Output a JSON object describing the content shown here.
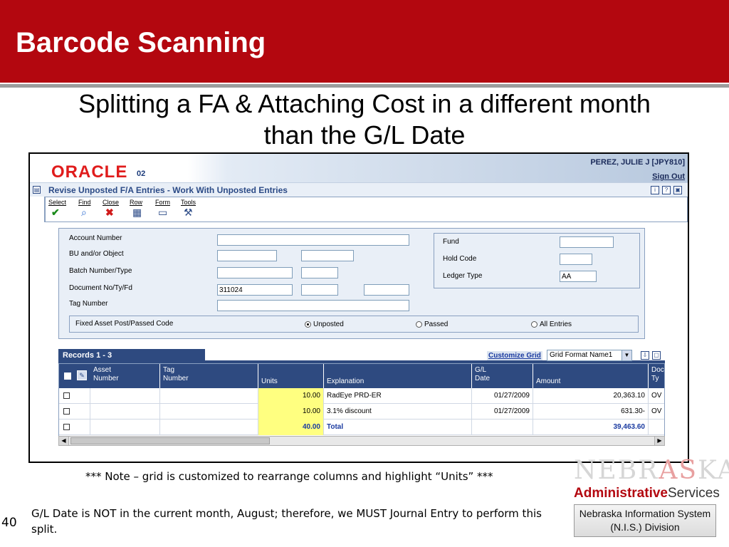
{
  "slide": {
    "title": "Barcode Scanning",
    "subtitle_line1": "Splitting a FA & Attaching Cost in a different month",
    "subtitle_line2": "than the G/L Date",
    "note": "*** Note – grid is customized to rearrange columns and highlight “Units” ***",
    "body": "G/L Date is NOT in the current month, August; therefore, we MUST Journal Entry to perform this split.",
    "slide_number": "40",
    "accent_color": "#b3070f"
  },
  "app": {
    "brand": "ORACLE",
    "version": "02",
    "user": "PEREZ, JULIE J [JPY810]",
    "sign_out": "Sign Out",
    "form_title": "Revise Unposted F/A Entries - Work With Unposted Entries",
    "toolbar": [
      {
        "label": "Select",
        "icon": "check-icon"
      },
      {
        "label": "Find",
        "icon": "find-icon"
      },
      {
        "label": "Close",
        "icon": "close-icon"
      },
      {
        "label": "Row",
        "icon": "row-icon"
      },
      {
        "label": "Form",
        "icon": "form-icon"
      },
      {
        "label": "Tools",
        "icon": "tools-icon"
      }
    ]
  },
  "search": {
    "account_number_label": "Account Number",
    "bu_object_label": "BU and/or Object",
    "batch_label": "Batch Number/Type",
    "document_label": "Document No/Ty/Fd",
    "document_value": "311024",
    "tag_label": "Tag Number",
    "fund_label": "Fund",
    "hold_code_label": "Hold Code",
    "ledger_type_label": "Ledger Type",
    "ledger_type_value": "AA",
    "post_code_label": "Fixed Asset Post/Passed Code",
    "radios": [
      {
        "label": "Unposted",
        "selected": true
      },
      {
        "label": "Passed",
        "selected": false
      },
      {
        "label": "All Entries",
        "selected": false
      }
    ]
  },
  "grid": {
    "records_label": "Records 1 - 3",
    "customize_label": "Customize Grid",
    "format_value": "Grid Format Name1",
    "columns": {
      "asset_1": "Asset",
      "asset_2": "Number",
      "tag_1": "Tag",
      "tag_2": "Number",
      "units": "Units",
      "explanation": "Explanation",
      "gl_1": "G/L",
      "gl_2": "Date",
      "amount": "Amount",
      "doc_1": "Doc",
      "doc_2": "Ty"
    },
    "rows": [
      {
        "units": "10.00",
        "explanation": "RadEye PRD-ER",
        "gl_date": "01/27/2009",
        "amount": "20,363.10",
        "doc_type": "OV"
      },
      {
        "units": "10.00",
        "explanation": "3.1% discount",
        "gl_date": "01/27/2009",
        "amount": "631.30-",
        "doc_type": "OV"
      },
      {
        "units": "40.00",
        "explanation": "Total",
        "gl_date": "",
        "amount": "39,463.60",
        "doc_type": ""
      }
    ]
  },
  "logo": {
    "nebraska_pre": "NEBR",
    "nebraska_accent": "AS",
    "nebraska_post": "KA",
    "admin": "Administrative",
    "services": "Services",
    "division_line1": "Nebraska Information System",
    "division_line2": "(N.I.S.) Division"
  }
}
